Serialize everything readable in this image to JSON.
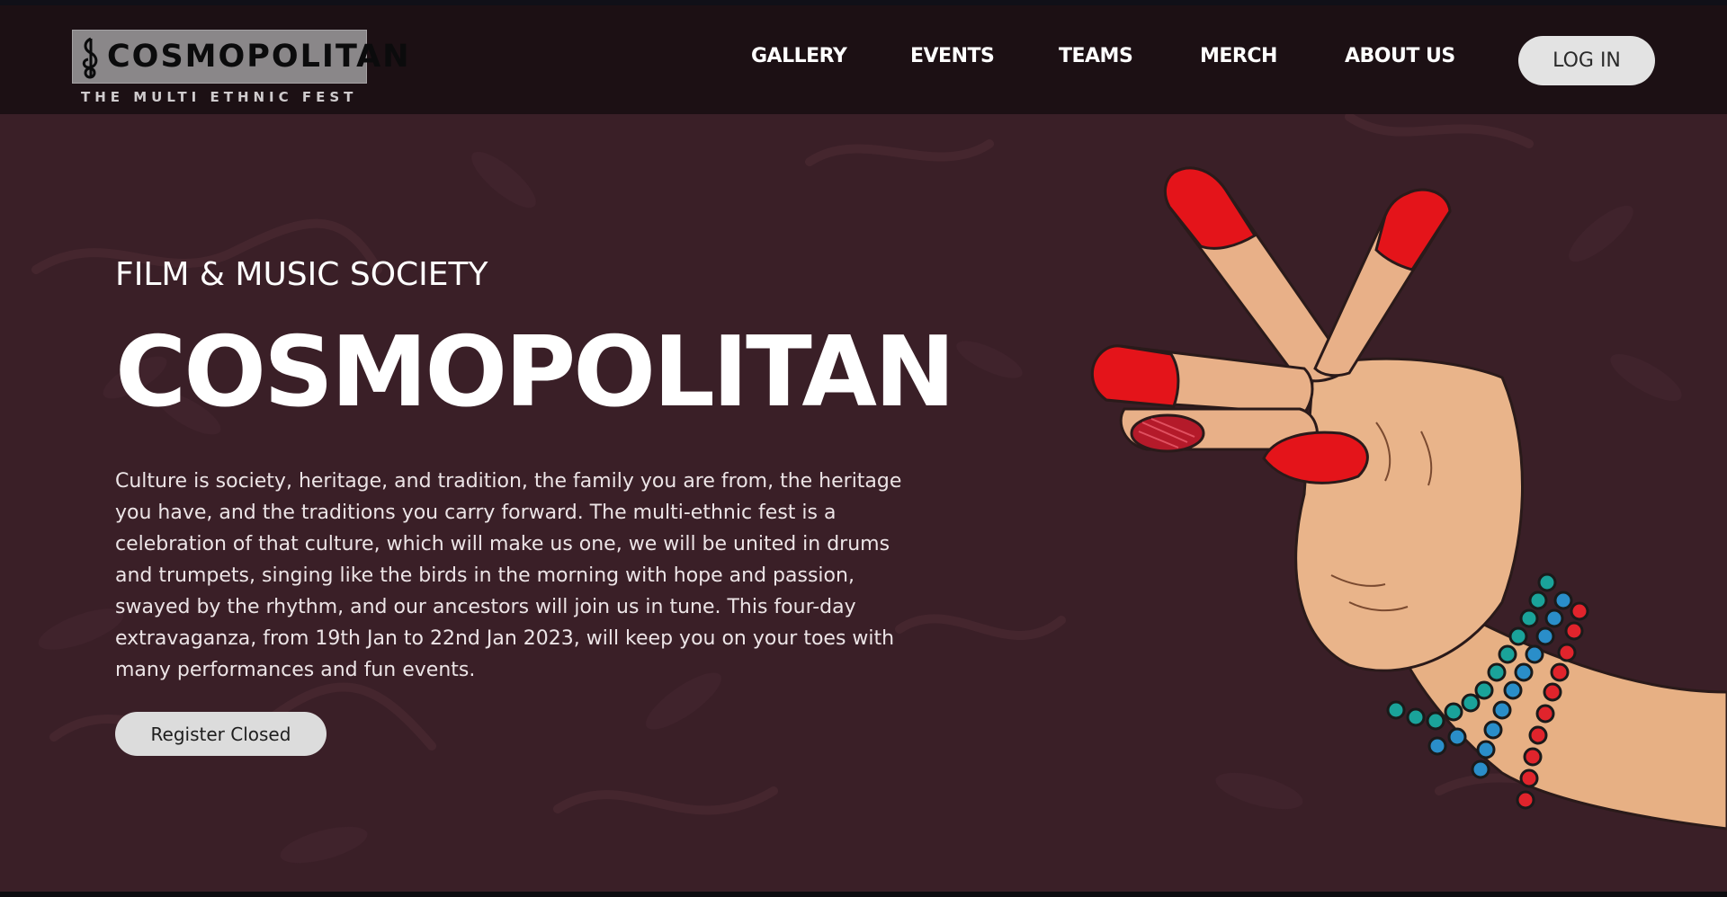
{
  "brand": {
    "name": "COSMOPOLITAN",
    "tagline": "THE MULTI ETHNIC FEST"
  },
  "nav": {
    "items": [
      {
        "label": "GALLERY"
      },
      {
        "label": "EVENTS"
      },
      {
        "label": "TEAMS"
      },
      {
        "label": "MERCH"
      },
      {
        "label": "ABOUT US"
      }
    ],
    "login_label": "LOG IN"
  },
  "hero": {
    "subtitle": "FILM & MUSIC SOCIETY",
    "title": "COSMOPOLITAN",
    "description": "Culture is society, heritage, and tradition, the family you are from, the heritage you have, and the traditions you carry forward. The multi-ethnic fest is a celebration of that culture, which will make us one, we will be united in drums and trumpets, singing like the birds in the morning with hope and passion, swayed by the rhythm, and our ancestors will join us in tune. This four-day extravaganza, from 19th Jan to 22nd Jan 2023, will keep you on your toes with many performances and fun events.",
    "register_label": "Register Closed"
  },
  "colors": {
    "background": "#3a1f27",
    "navbar": "#1c1014",
    "nail_red": "#e4141a",
    "skin": "#e8b48a",
    "bead_teal": "#1aa39a",
    "bead_blue": "#2a8ec9",
    "bead_red": "#e0242c"
  },
  "icons": {
    "logo_mark": "treble-clef-icon",
    "hero_art": "mudra-hand-illustration"
  }
}
